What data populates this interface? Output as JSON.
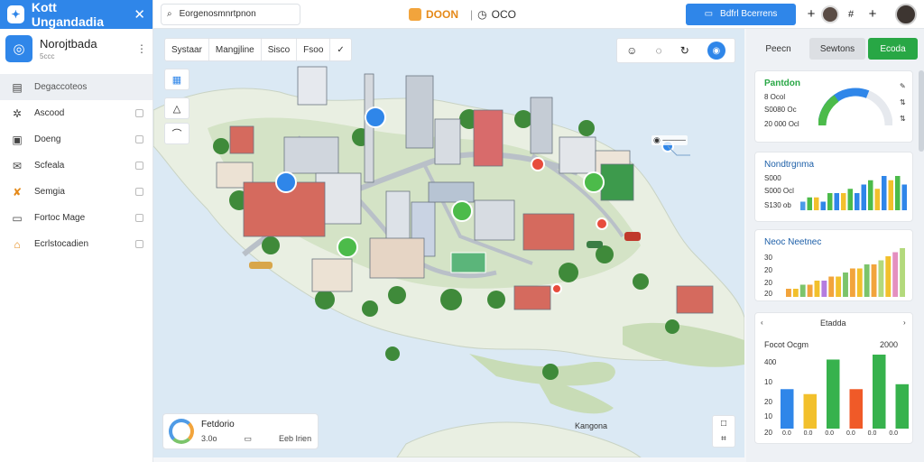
{
  "sidebar": {
    "app_title": "Kott Ungandadia",
    "project": {
      "name": "Norojtbada",
      "subtitle": "5ccc"
    },
    "items": [
      {
        "label": "Degaccoteos",
        "icon": "grid-icon"
      },
      {
        "label": "Ascood",
        "icon": "settings-icon"
      },
      {
        "label": "Doeng",
        "icon": "table-icon"
      },
      {
        "label": "Scfeala",
        "icon": "mail-icon"
      },
      {
        "label": "Semgia",
        "icon": "tools-icon"
      },
      {
        "label": "Fortoc Mage",
        "icon": "document-icon"
      },
      {
        "label": "Ecrlstocadien",
        "icon": "building-icon"
      }
    ]
  },
  "topbar": {
    "search_value": "Eorgenosmnrtpnon",
    "brand": "DOON",
    "brand_sub": "OCO",
    "primary_button": "Bdfrl Bcerrens"
  },
  "map": {
    "tabs": [
      "Systaar",
      "Mangjline",
      "Sisco",
      "Fsoo"
    ],
    "info_card": {
      "title": "Fetdorio",
      "value": "3.0o",
      "link": "Eeb Irien"
    },
    "labels": [
      "Kangona"
    ]
  },
  "right_panel": {
    "tabs": [
      "Peecn",
      "Sewtons",
      "Ecoda"
    ],
    "card1": {
      "title": "Pantdon",
      "rows": [
        "8 Ocol",
        "S0080 Oc",
        "20 000 Ocl"
      ],
      "colors": {
        "gauge": "#2f86e9",
        "gauge2": "#4cbb4a"
      },
      "progress": 0.62
    },
    "card2": {
      "title": "Nondtrgnma",
      "rows": [
        "S000",
        "S000 Ocl",
        "S130 ob"
      ],
      "bar_values": [
        2,
        3,
        3,
        2,
        4,
        4,
        4,
        5,
        4,
        6,
        7,
        5,
        8,
        7,
        8,
        6
      ],
      "bar_colors": [
        "#4c9be8",
        "#4cbb4a",
        "#f2c02c",
        "#2f86e9",
        "#4cbb4a",
        "#2f86e9",
        "#f2c02c",
        "#4cbb4a",
        "#2f86e9",
        "#2f86e9",
        "#4cbb4a",
        "#f2c02c",
        "#2f86e9",
        "#f2c02c",
        "#4cbb4a",
        "#2f86e9"
      ]
    },
    "card3": {
      "title": "Neoc Neetnec",
      "rows": [
        "30",
        "20",
        "20",
        "20"
      ],
      "bar_values": [
        2,
        2,
        3,
        3,
        4,
        4,
        5,
        5,
        6,
        7,
        7,
        8,
        8,
        9,
        10,
        11,
        12
      ],
      "bar_colors": [
        "#f2a43c",
        "#f2c02c",
        "#7cc46b",
        "#f2a43c",
        "#f2c02c",
        "#b47ce0",
        "#f2a43c",
        "#f2c02c",
        "#7cc46b",
        "#f2a43c",
        "#f2c02c",
        "#7cc46b",
        "#f2a43c",
        "#b3d97c",
        "#f2c02c",
        "#e48fc0",
        "#b3d97c"
      ]
    },
    "card4": {
      "header": "Etadda",
      "title": "Focot Ocgm",
      "value": "2000",
      "yticks": [
        "400",
        "10",
        "20",
        "10",
        "20"
      ],
      "xticks": [
        "0.0",
        "0.0",
        "0.0",
        "0.0",
        "0.0",
        "0.0"
      ],
      "bar_values": [
        8,
        7,
        14,
        8,
        15,
        9
      ],
      "bar_colors": [
        "#2f86e9",
        "#f2c02c",
        "#37b24d",
        "#f05a28",
        "#37b24d",
        "#37b24d"
      ]
    }
  }
}
